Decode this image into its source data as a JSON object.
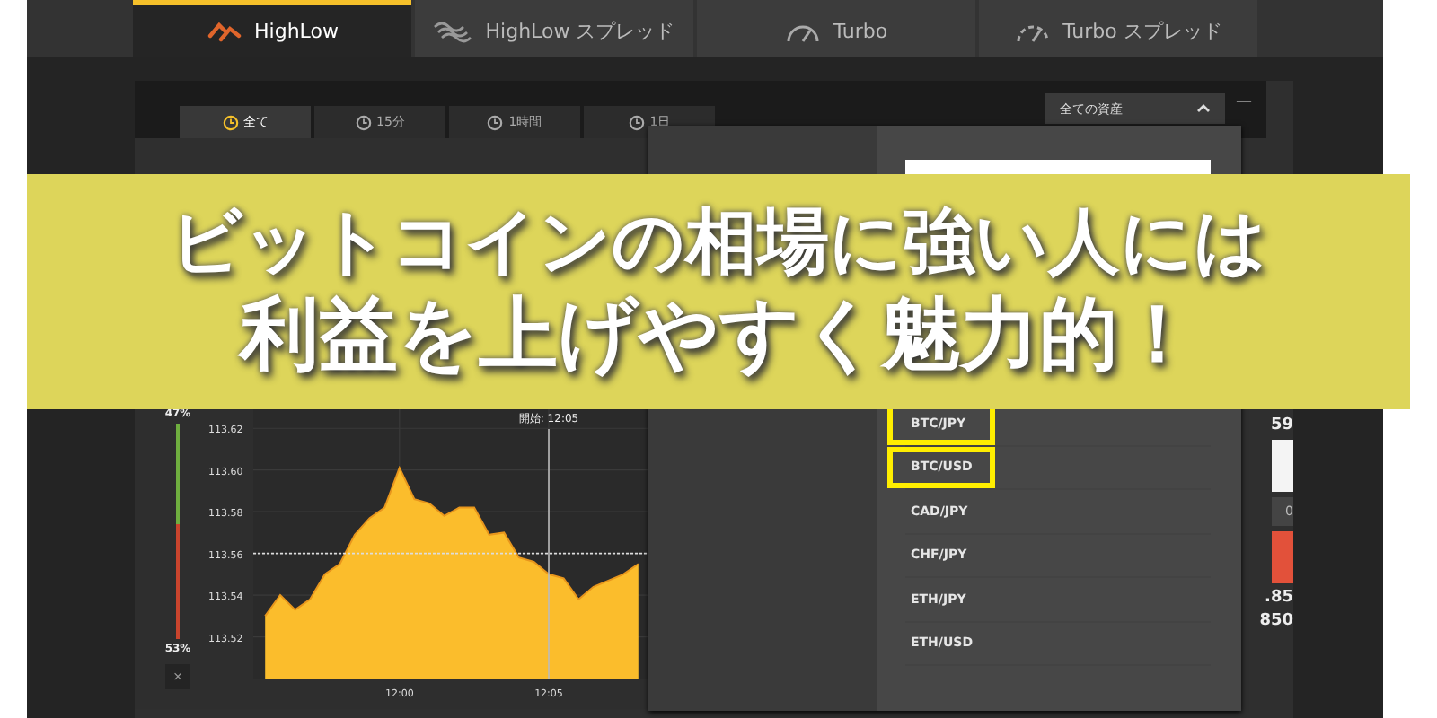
{
  "product_tabs": [
    {
      "label": "HighLow",
      "kind": "highlow",
      "selected": true
    },
    {
      "label": "HighLow スプレッド",
      "kind": "spread",
      "selected": false
    },
    {
      "label": "Turbo",
      "kind": "turbo",
      "selected": false
    },
    {
      "label": "Turbo スプレッド",
      "kind": "turbo_spread",
      "selected": false
    }
  ],
  "period_tabs": [
    {
      "label": "全て",
      "selected": true
    },
    {
      "label": "15分",
      "selected": false
    },
    {
      "label": "1時間",
      "selected": false
    },
    {
      "label": "1日",
      "selected": false
    }
  ],
  "asset_filter": {
    "label": "全ての資産",
    "expanded": true,
    "minimize": "—"
  },
  "asset_list": [
    {
      "label": "BTC/JPY",
      "highlighted": true
    },
    {
      "label": "BTC/USD",
      "highlighted": true
    },
    {
      "label": "CAD/JPY",
      "highlighted": false
    },
    {
      "label": "CHF/JPY",
      "highlighted": false
    },
    {
      "label": "ETH/JPY",
      "highlighted": false
    },
    {
      "label": "ETH/USD",
      "highlighted": false
    }
  ],
  "meter": {
    "up_label": "47%",
    "down_label": "53%",
    "level": 0.47,
    "close": "×"
  },
  "chart": {
    "chart_data": {
      "type": "area",
      "categories": [
        null,
        null,
        null,
        null,
        null,
        null,
        null,
        null,
        null,
        "12:00",
        null,
        null,
        null,
        null,
        null,
        null,
        null,
        null,
        null,
        "12:05",
        null,
        null,
        null,
        null,
        null,
        null
      ],
      "series": [
        {
          "color": "#fbbd2c",
          "values": [
            113.53,
            113.54,
            113.533,
            113.538,
            113.55,
            113.555,
            113.569,
            113.577,
            113.582,
            113.601,
            113.586,
            113.584,
            113.578,
            113.582,
            113.582,
            113.569,
            113.57,
            113.558,
            113.556,
            113.55,
            113.548,
            113.538,
            113.544,
            113.547,
            113.55,
            113.555
          ]
        }
      ],
      "ylim": [
        113.5,
        113.63
      ],
      "yticks": [
        {
          "value": 113.52,
          "label": "113.52"
        },
        {
          "value": 113.54,
          "label": "113.54"
        },
        {
          "value": 113.56,
          "label": "113.56"
        },
        {
          "value": 113.58,
          "label": "113.58"
        },
        {
          "value": 113.6,
          "label": "113.60"
        },
        {
          "value": 113.62,
          "label": "113.62"
        }
      ],
      "grid": true,
      "annotations": [
        {
          "x": "12:05",
          "text": "開始: 12:05"
        }
      ],
      "ref_lines": [
        {
          "axis": "y",
          "value": 113.56
        }
      ]
    }
  },
  "trade_column": [
    {
      "kind": "value",
      "text": "59"
    },
    {
      "kind": "block",
      "color": "#f4f4f4"
    },
    {
      "kind": "field",
      "text": "0"
    },
    {
      "kind": "block",
      "color": "#e2513a"
    },
    {
      "kind": "value",
      "text": ".85"
    },
    {
      "kind": "value",
      "text": "850"
    }
  ],
  "banner": {
    "lines": [
      "ビットコインの相場に強い人には",
      "利益を上げやすく魅力的！"
    ]
  }
}
